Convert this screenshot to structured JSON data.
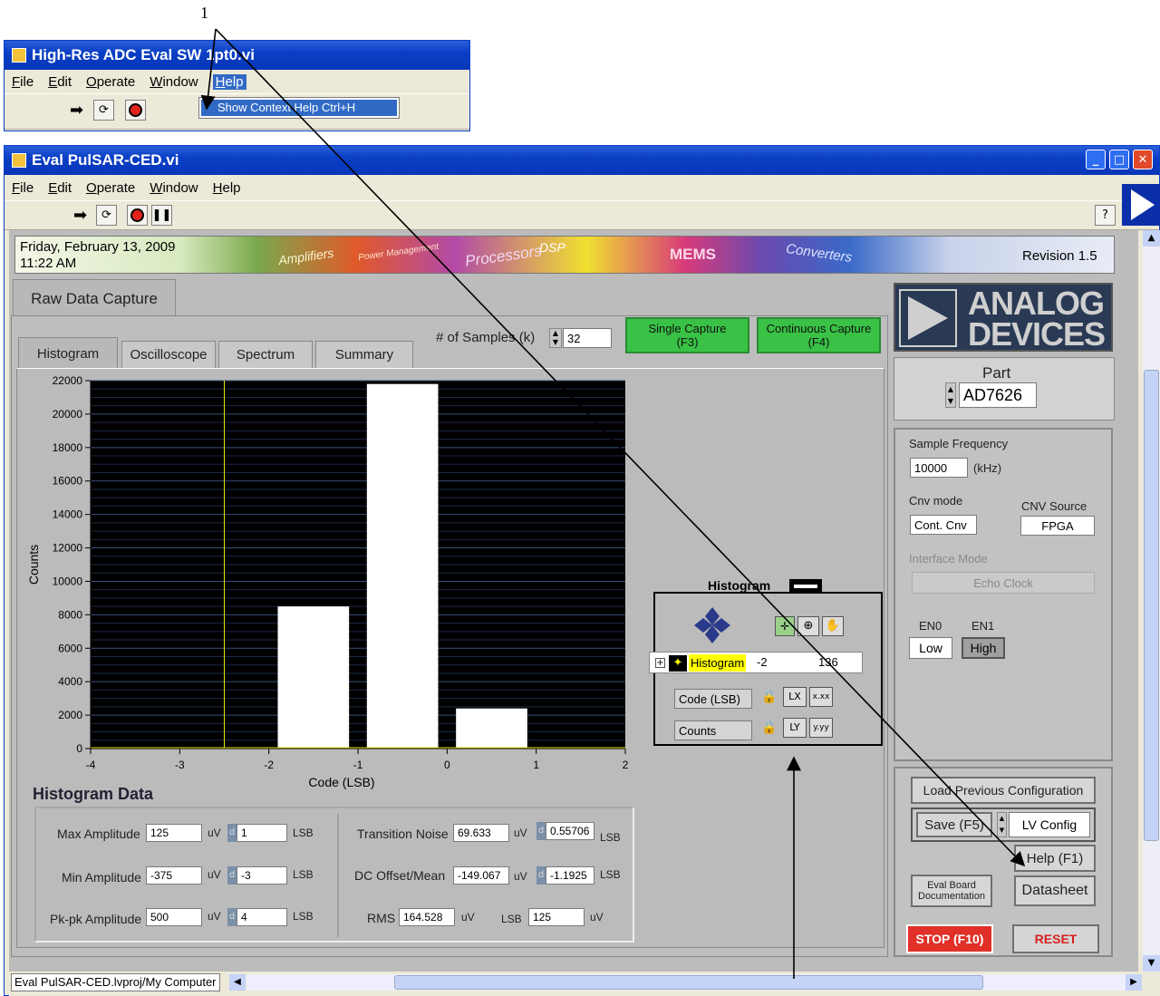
{
  "annotation": {
    "number": "1"
  },
  "top_window": {
    "title": "High-Res ADC Eval SW 1pt0.vi",
    "menu": [
      "File",
      "Edit",
      "Operate",
      "Window",
      "Help"
    ],
    "help_item": "Show Context Help  Ctrl+H"
  },
  "main_window": {
    "title": "Eval PulSAR-CED.vi",
    "menu": [
      "File",
      "Edit",
      "Operate",
      "Window",
      "Help"
    ],
    "help_glyph": "?"
  },
  "banner": {
    "date": "Friday, February 13, 2009",
    "time": "11:22 AM",
    "revision": "Revision 1.5",
    "strip_words": [
      "Amplifiers",
      "Power Management",
      "Processors",
      "DSP",
      "MEMS",
      "Converters"
    ]
  },
  "logo": {
    "line1": "ANALOG",
    "line2": "DEVICES"
  },
  "tabs": {
    "outer": "Raw Data Capture",
    "inner": [
      "Histogram",
      "Oscilloscope",
      "Spectrum",
      "Summary"
    ]
  },
  "samples": {
    "label": "# of Samples (k)",
    "value": "32"
  },
  "buttons": {
    "single_capture": "Single Capture",
    "single_key": "(F3)",
    "continuous_capture": "Continuous Capture",
    "continuous_key": "(F4)",
    "load_prev": "Load Previous Configuration",
    "save": "Save (F5)",
    "lv_config": "LV Config",
    "help": "Help (F1)",
    "eval_board_1": "Eval Board",
    "eval_board_2": "Documentation",
    "datasheet": "Datasheet",
    "stop": "STOP (F10)",
    "reset": "RESET"
  },
  "chart_data": {
    "type": "bar",
    "x": [
      -1.5,
      -0.5,
      0.5
    ],
    "values": [
      8500,
      21800,
      2400
    ],
    "xlabel": "Code (LSB)",
    "ylabel": "Counts",
    "xlim": [
      -4,
      2
    ],
    "ylim": [
      0,
      22000
    ],
    "xticks": [
      "-4",
      "-3",
      "-2",
      "-1",
      "0",
      "1",
      "2"
    ],
    "yticks": [
      "0",
      "2000",
      "4000",
      "6000",
      "8000",
      "10000",
      "12000",
      "14000",
      "16000",
      "18000",
      "20000",
      "22000"
    ],
    "cursor_x": -2.5,
    "background": "#000000",
    "bar_color": "#ffffff",
    "grid": true
  },
  "legend_panel": {
    "title": "Histogram",
    "cursor_name": "Histogram",
    "cursor_x": "-2",
    "cursor_y": "136",
    "x_axis_name": "Code (LSB)",
    "y_axis_name": "Counts"
  },
  "histogram_data": {
    "title": "Histogram Data",
    "max_amp": {
      "label": "Max Amplitude",
      "uv": "125",
      "lsb": "1"
    },
    "min_amp": {
      "label": "Min Amplitude",
      "uv": "-375",
      "lsb": "-3"
    },
    "pkpk_amp": {
      "label": "Pk-pk Amplitude",
      "uv": "500",
      "lsb": "4"
    },
    "transition_noise": {
      "label": "Transition Noise",
      "uv": "69.633",
      "lsb": "0.55706"
    },
    "dc_offset": {
      "label": "DC Offset/Mean",
      "uv": "-149.067",
      "lsb": "-1.1925"
    },
    "rms": {
      "label": "RMS",
      "uv": "164.528",
      "lsb": "125"
    },
    "unit_uv": "uV",
    "unit_lsb": "LSB",
    "d_glyph": "d"
  },
  "part": {
    "label": "Part",
    "value": "AD7626"
  },
  "config": {
    "sample_freq_label": "Sample Frequency",
    "sample_freq_value": "10000",
    "sample_freq_unit": "(kHz)",
    "cnv_mode_label": "Cnv mode",
    "cnv_mode_value": "Cont. Cnv",
    "cnv_source_label": "CNV Source",
    "cnv_source_value": "FPGA",
    "interface_label": "Interface Mode",
    "interface_value": "Echo Clock",
    "en0_label": "EN0",
    "en0_value": "Low",
    "en1_label": "EN1",
    "en1_value": "High"
  },
  "status": {
    "path": "Eval PulSAR-CED.lvproj/My Computer"
  },
  "colors": {
    "green": "#39c245",
    "stop_red": "#e03027",
    "xp_blue": "#0a3fc6",
    "panel": "#bcbcbc"
  }
}
